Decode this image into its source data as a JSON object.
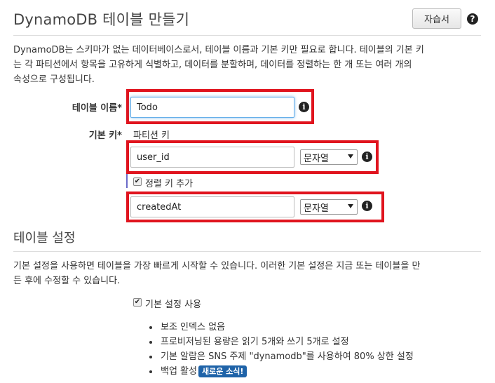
{
  "header": {
    "title": "DynamoDB 테이블 만들기",
    "tutorial_label": "자습서",
    "help_glyph": "?"
  },
  "intro": {
    "line1": "DynamoDB는 스키마가 없는 데이터베이스로서, 테이블 이름과 기본 키만 필요로 합니다. 테이블의 기본 키",
    "line2": "는 각 파티션에서 항목을 고유하게 식별하고, 데이터를 분할하며, 데이터를 정렬하는 한 개 또는 여러 개의",
    "line3": "속성으로 구성됩니다."
  },
  "form": {
    "table_name_label": "테이블 이름*",
    "table_name_value": "Todo",
    "primary_key_label": "기본 키*",
    "partition_key_label": "파티션 키",
    "partition_key_value": "user_id",
    "partition_key_type": "문자열",
    "add_sort_key_label": "정렬 키 추가",
    "add_sort_key_checked": true,
    "sort_key_value": "createdAt",
    "sort_key_type": "문자열",
    "info_glyph": "i"
  },
  "table_settings": {
    "title": "테이블 설정",
    "desc_line1": "기본 설정을 사용하면 테이블을 가장 빠르게 시작할 수 있습니다. 이러한 기본 설정은 지금 또는 테이블을 만",
    "desc_line2": "든 후에 수정할 수 있습니다.",
    "use_default_label": "기본 설정 사용",
    "use_default_checked": true,
    "bullets": [
      "보조 인덱스 없음",
      "프로비저닝된 용량은 읽기 5개와 쓰기 5개로 설정",
      "기본 알람은 SNS 주제 \"dynamodb\"를 사용하여 80% 상한 설정",
      "백업 활성"
    ],
    "new_badge": "새로운 소식!"
  },
  "colors": {
    "highlight_red": "#e0141e",
    "badge_blue": "#1f63a8",
    "focus_blue": "#66afe9"
  }
}
